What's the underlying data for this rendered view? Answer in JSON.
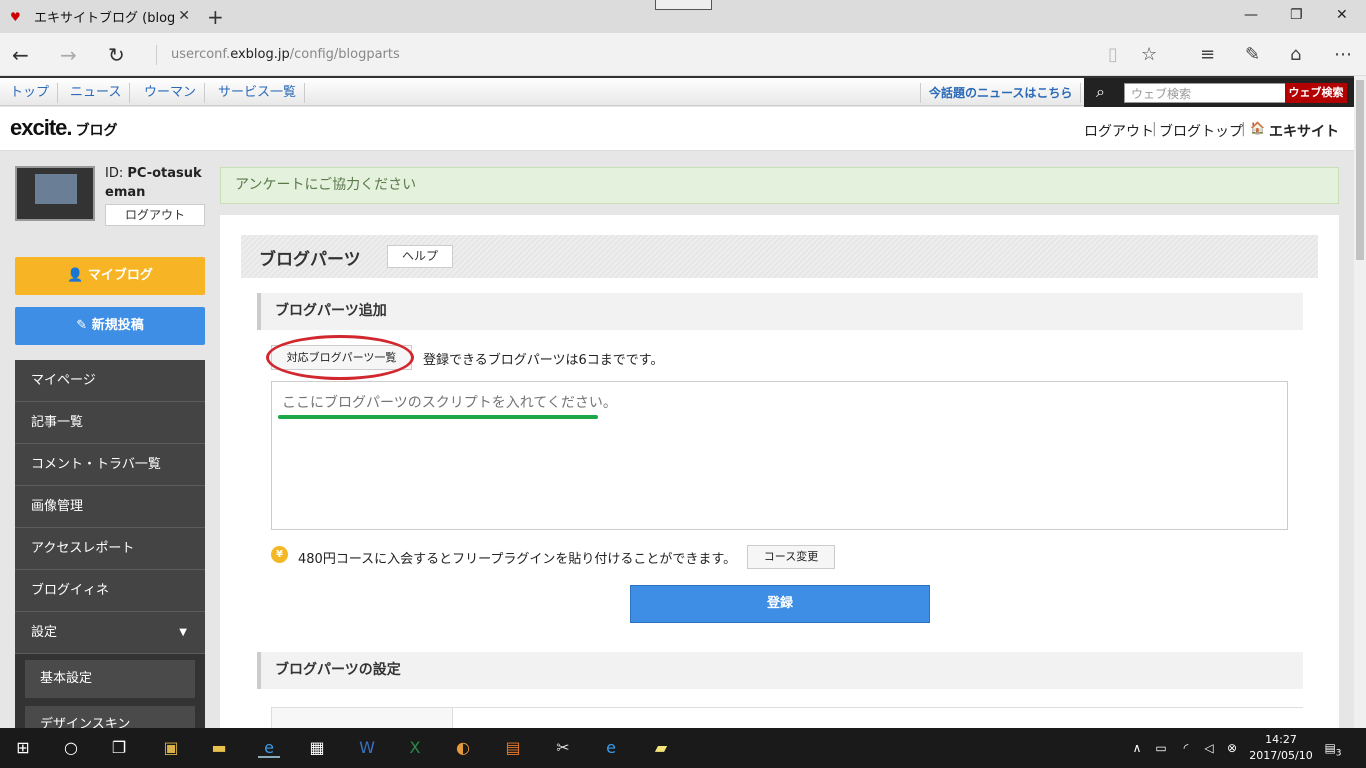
{
  "browser": {
    "tab_title": "エキサイトブログ (blog)|ブロ",
    "new_tab": "+",
    "close_tab": "✕",
    "url_host": "userconf.",
    "url_domain": "exblog.jp",
    "url_path": "/config/blogparts",
    "window_controls": {
      "minimize": "—",
      "restore": "❐",
      "close": "✕"
    }
  },
  "excite_bar": {
    "links": [
      "トップ",
      "ニュース",
      "ウーマン",
      "サービス一覧"
    ],
    "hot_news": "今話題のニュースはこちら",
    "search_placeholder": "ウェブ検索",
    "search_button": "ウェブ検索"
  },
  "site_header": {
    "logo": "excite.",
    "logo_blog": "ブログ",
    "links": [
      "ログアウト",
      "ブログトップ",
      "エキサイト"
    ]
  },
  "sidebar": {
    "user_id_label": "ID: ",
    "user_id": "PC-otasukeman",
    "logout": "ログアウト",
    "myblog": "マイブログ",
    "new_post": "新規投稿",
    "menu": [
      "マイページ",
      "記事一覧",
      "コメント・トラバ一覧",
      "画像管理",
      "アクセスレポート",
      "ブログイィネ",
      "設定"
    ],
    "submenu": [
      "基本設定",
      "デザインスキン"
    ]
  },
  "notice": "アンケートにご協力ください",
  "main": {
    "title": "ブログパーツ",
    "help": "ヘルプ",
    "add_section": "ブログパーツ追加",
    "list_button": "対応ブログパーツ一覧",
    "limit_text": "登録できるブログパーツは6コまでです。",
    "textarea_placeholder": "ここにブログパーツのスクリプトを入れてください。",
    "course_text": "480円コースに入会するとフリープラグインを貼り付けることができます。",
    "course_button": "コース変更",
    "submit": "登録",
    "settings_section": "ブログパーツの設定"
  },
  "taskbar": {
    "time": "14:27",
    "date": "2017/05/10",
    "notifications": "3"
  }
}
